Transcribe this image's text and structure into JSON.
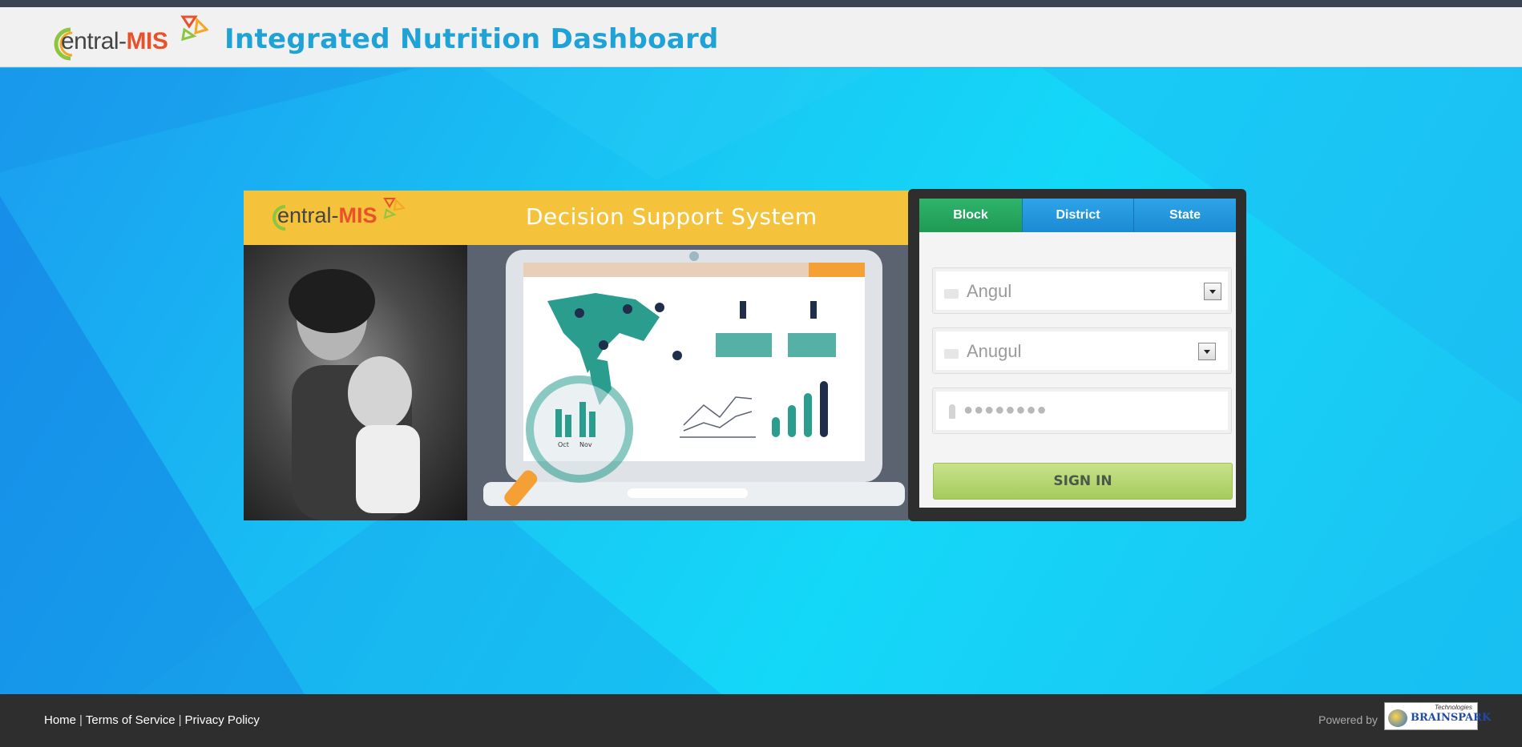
{
  "header": {
    "logo": {
      "prefix": "entral-",
      "suffix": "MIS",
      "initial": "C"
    },
    "title": "Integrated Nutrition Dashboard"
  },
  "banner": {
    "logo": {
      "prefix": "entral-",
      "suffix": "MIS"
    },
    "title": "Decision Support System",
    "chart_labels": [
      "Oct",
      "Nov"
    ]
  },
  "login": {
    "tabs": [
      {
        "label": "Block",
        "active": true
      },
      {
        "label": "District",
        "active": false
      },
      {
        "label": "State",
        "active": false
      }
    ],
    "district_select": {
      "value": "Angul"
    },
    "block_select": {
      "value": "Anugul"
    },
    "password": {
      "value": "●●●●●●●●"
    },
    "signin_label": "SIGN IN"
  },
  "footer": {
    "links": [
      {
        "label": "Home"
      },
      {
        "label": "Terms of Service"
      },
      {
        "label": "Privacy Policy"
      }
    ],
    "separator": "|",
    "powered_by": "Powered by",
    "brand": {
      "name": "BRAINSPARK",
      "tagline": "Technologies"
    }
  },
  "colors": {
    "accent": "#1fa2d6",
    "banner_yellow": "#f5c33b",
    "tab_active": "#2fb36a",
    "tab_inactive": "#1a8ad4",
    "signin": "#a6cb5c",
    "mis_orange": "#e9512b"
  }
}
